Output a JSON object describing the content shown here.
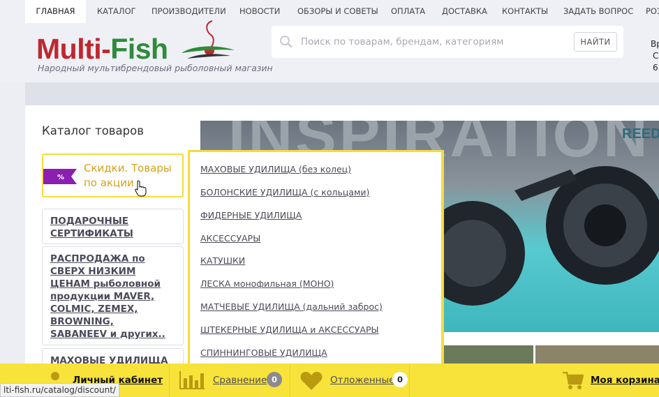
{
  "header": {
    "logo_multi": "Multi-",
    "logo_fish": "Fish",
    "tagline": "Народный мультибрендовый рыболовный магазин",
    "search_placeholder": "Поиск по товарам, брендам, категориям",
    "search_button": "НАЙТИ",
    "side_note_lines": [
      "Вр",
      "С",
      "6"
    ]
  },
  "nav": {
    "items": [
      "ГЛАВНАЯ",
      "КАТАЛОГ",
      "ПРОИЗВОДИТЕЛИ",
      "НОВОСТИ",
      "ОБЗОРЫ И СОВЕТЫ",
      "ОПЛАТА",
      "ДОСТАВКА",
      "КОНТАКТЫ",
      "ЗАДАТЬ ВОПРОС",
      "РОЗ"
    ],
    "active_index": 0
  },
  "sidebar": {
    "title": "Каталог товаров",
    "promo": {
      "badge": "%",
      "label": "Скидки. Товары по акции"
    },
    "categories": [
      "ПОДАРОЧНЫЕ СЕРТИФИКАТЫ",
      "РАСПРОДАЖА по СВЕРХ НИЗКИМ ЦЕНАМ рыболовной продукции MAVER, COLMIC, ZEMEX, BROWNING, SABANEEV и других..",
      "МАХОВЫЕ УДИЛИЩА"
    ]
  },
  "dropdown": {
    "items": [
      "МАХОВЫЕ УДИЛИЩА (без колец)",
      "БОЛОНСКИЕ УДИЛИЩА (с кольцами)",
      "ФИДЕРНЫЕ УДИЛИЩА",
      "АКСЕССУАРЫ",
      "КАТУШКИ",
      "ЛЕСКА монофильная (МОНО)",
      "МАТЧЕВЫЕ УДИЛИЩА (дальний заброс)",
      "ШТЕКЕРНЫЕ УДИЛИЩА и АКСЕССУАРЫ",
      "СПИННИНГОВЫЕ УДИЛИЩА"
    ]
  },
  "banner": {
    "headline": "INSPIRATION",
    "brand": "REED"
  },
  "bottom_bar": {
    "account": "Личный кабинет",
    "compare": "Сравнение",
    "compare_count": "0",
    "saved": "Отложенные",
    "saved_count": "0",
    "cart": "Моя корзина"
  },
  "status_url": "lti-fish.ru/catalog/discount/",
  "colors": {
    "accent_yellow": "#f8e33a",
    "brand_red": "#c0272d",
    "brand_green": "#2f8b3a",
    "promo_purple": "#8a1fb0",
    "promo_text": "#d4a21a"
  },
  "icons": [
    "search-icon",
    "percent-badge-icon",
    "pointer-cursor-icon",
    "user-icon",
    "bar-chart-icon",
    "heart-icon",
    "cart-icon"
  ]
}
